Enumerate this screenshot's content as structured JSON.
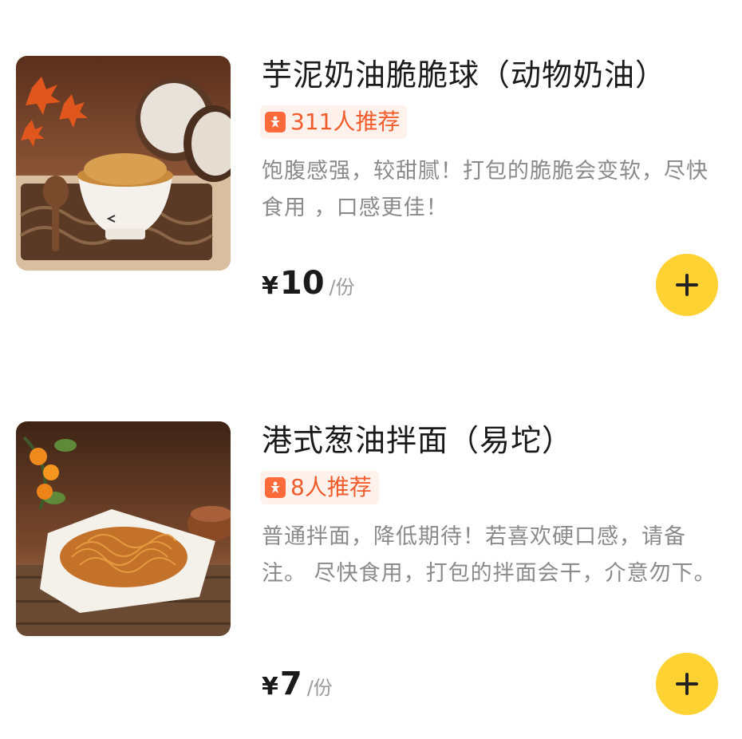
{
  "items": [
    {
      "title": "芋泥奶油脆脆球（动物奶油）",
      "recommend": "311人推荐",
      "description": "饱腹感强，较甜腻！打包的脆脆会变软，尽快食用 ，口感更佳！",
      "price_symbol": "¥",
      "price": "10",
      "unit": "/份",
      "icon": "recommend-person-icon"
    },
    {
      "title": "港式葱油拌面（易坨）",
      "recommend": "8人推荐",
      "description": "普通拌面，降低期待！若喜欢硬口感，请备注。 尽快食用，打包的拌面会干，介意勿下。",
      "price_symbol": "¥",
      "price": "7",
      "unit": "/份",
      "icon": "recommend-person-icon"
    }
  ],
  "colors": {
    "accent": "#ffd233",
    "recommend_text": "#f25b2a",
    "recommend_bg": "#fff1ec"
  }
}
